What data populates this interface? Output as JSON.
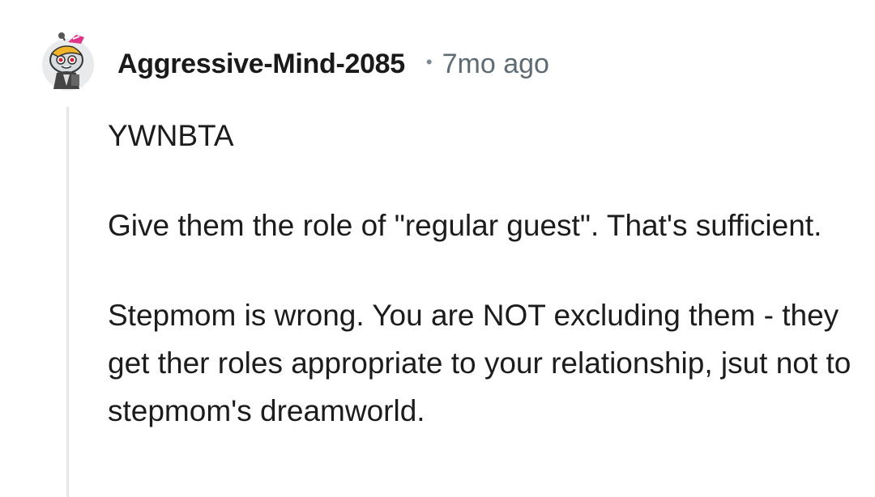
{
  "comment": {
    "author": "Aggressive-Mind-2085",
    "separator": "•",
    "timestamp": "7mo ago",
    "avatar_icon": "snoo-avatar-icon",
    "paragraphs": [
      "YWNBTA",
      "Give them the role of \"regular guest\". That's sufficient.",
      "Stepmom is wrong. You are NOT excluding them - they get ther roles appropriate to your relationship, jsut not to stepmom's dreamworld."
    ]
  },
  "colors": {
    "text": "#1a1a1b",
    "meta": "#5f6b72",
    "thread_line": "#e4e6e8",
    "background": "#ffffff"
  }
}
